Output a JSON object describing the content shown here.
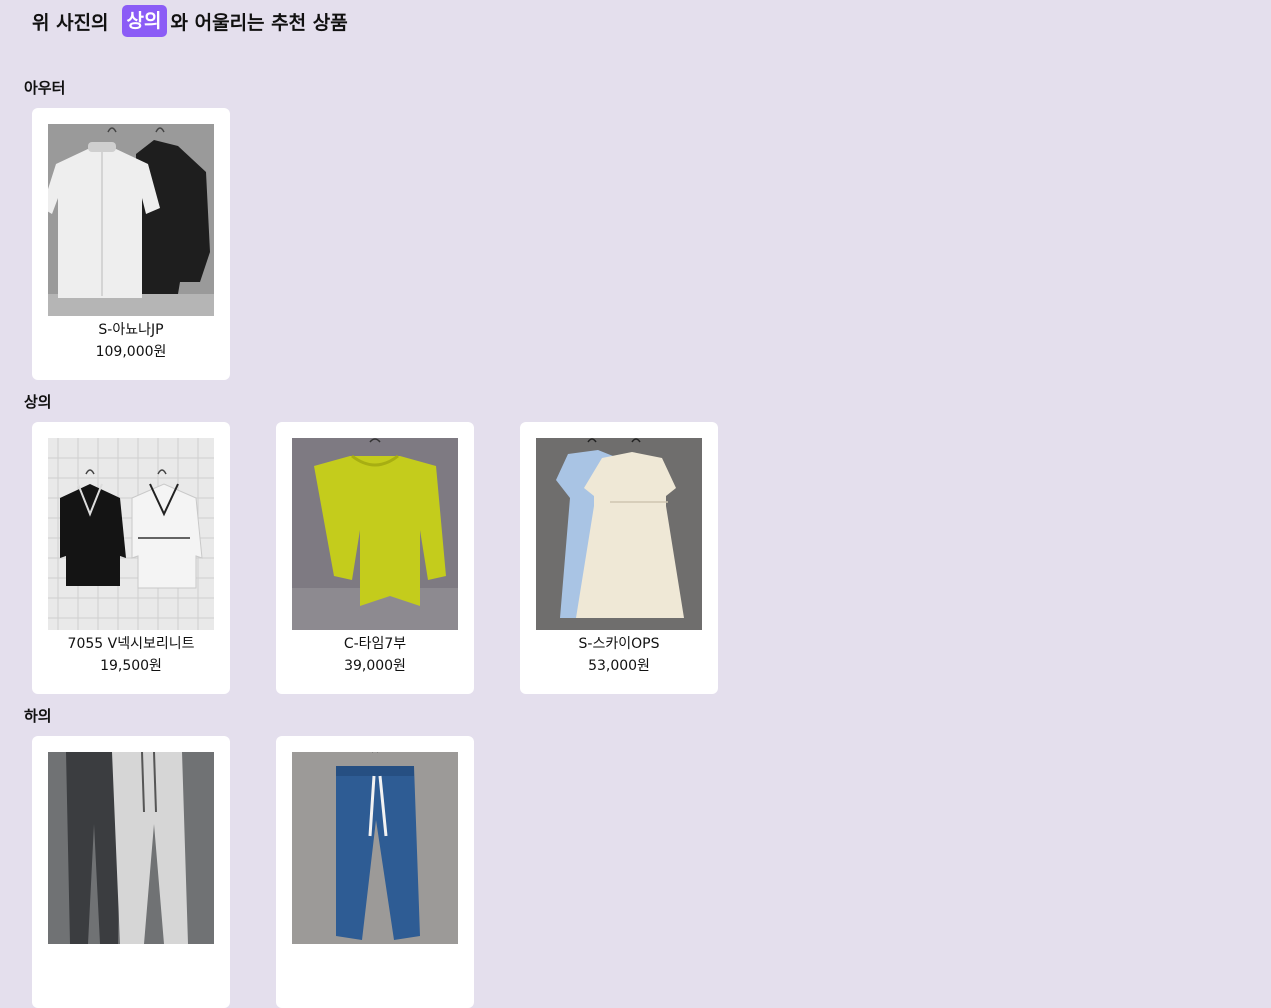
{
  "header": {
    "prefix": "위 사진의",
    "category": "상의",
    "suffix": "와 어울리는 추천 상품"
  },
  "sections": [
    {
      "label": "아우터",
      "items": [
        {
          "name": "S-아뇨나JP",
          "price": "109,000원",
          "image": "two-jackets-white-black"
        }
      ]
    },
    {
      "label": "상의",
      "items": [
        {
          "name": "7055 V넥시보리니트",
          "price": "19,500원",
          "image": "v-neck-knits-black-white"
        },
        {
          "name": "C-타임7부",
          "price": "39,000원",
          "image": "lime-sweatshirt"
        },
        {
          "name": "S-스카이OPS",
          "price": "53,000원",
          "image": "two-dresses-blue-cream"
        }
      ]
    },
    {
      "label": "하의",
      "items": [
        {
          "name": "",
          "price": "",
          "image": "jogger-pants-gray"
        },
        {
          "name": "",
          "price": "",
          "image": "denim-jogger-pants"
        }
      ]
    }
  ]
}
